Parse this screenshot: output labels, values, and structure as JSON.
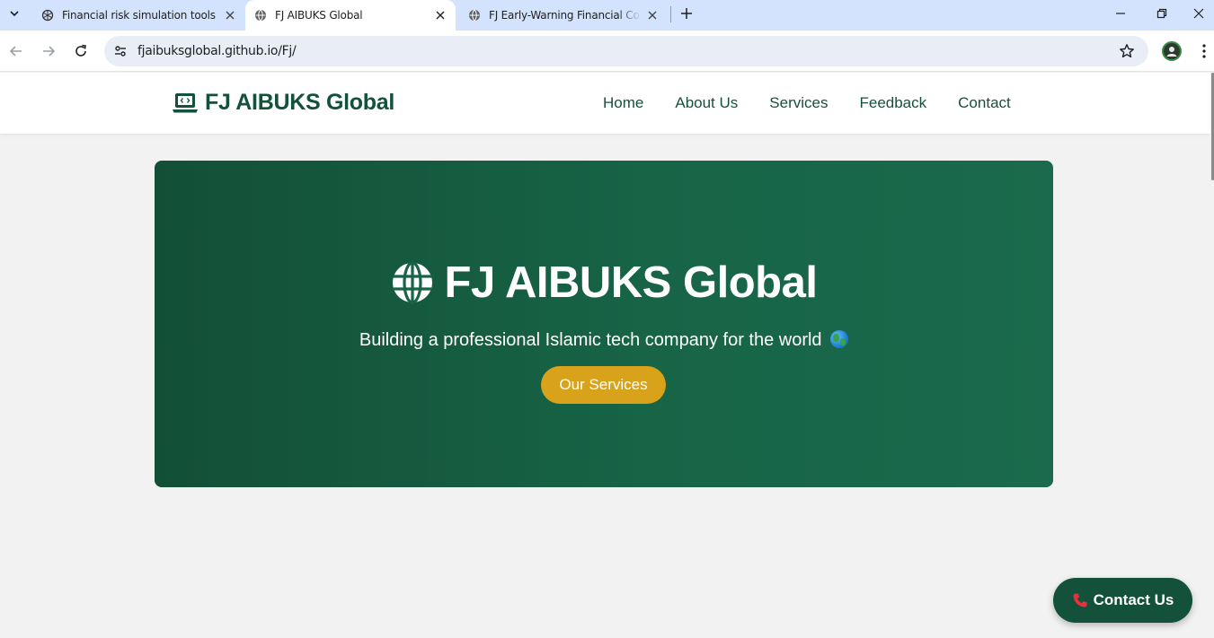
{
  "browser": {
    "tabs": [
      {
        "title": "Financial risk simulation tools",
        "icon": "openai-icon",
        "active": false
      },
      {
        "title": "FJ AIBUKS Global",
        "icon": "globe-icon",
        "active": true
      },
      {
        "title": "FJ Early-Warning Financial Control",
        "icon": "globe-icon",
        "active": false
      }
    ],
    "url": "fjaibuksglobal.github.io/Fj/"
  },
  "site": {
    "logo_text": "FJ AIBUKS Global",
    "nav": [
      "Home",
      "About Us",
      "Services",
      "Feedback",
      "Contact"
    ],
    "hero": {
      "title": "FJ AIBUKS Global",
      "subtitle": "Building a professional Islamic tech company for the world",
      "button": "Our Services"
    },
    "floating_button": "Contact Us"
  },
  "colors": {
    "brand_green": "#14513a",
    "accent_gold": "#d9a21b",
    "page_bg": "#f2f2f2",
    "tabstrip_bg": "#d3e3fd"
  }
}
